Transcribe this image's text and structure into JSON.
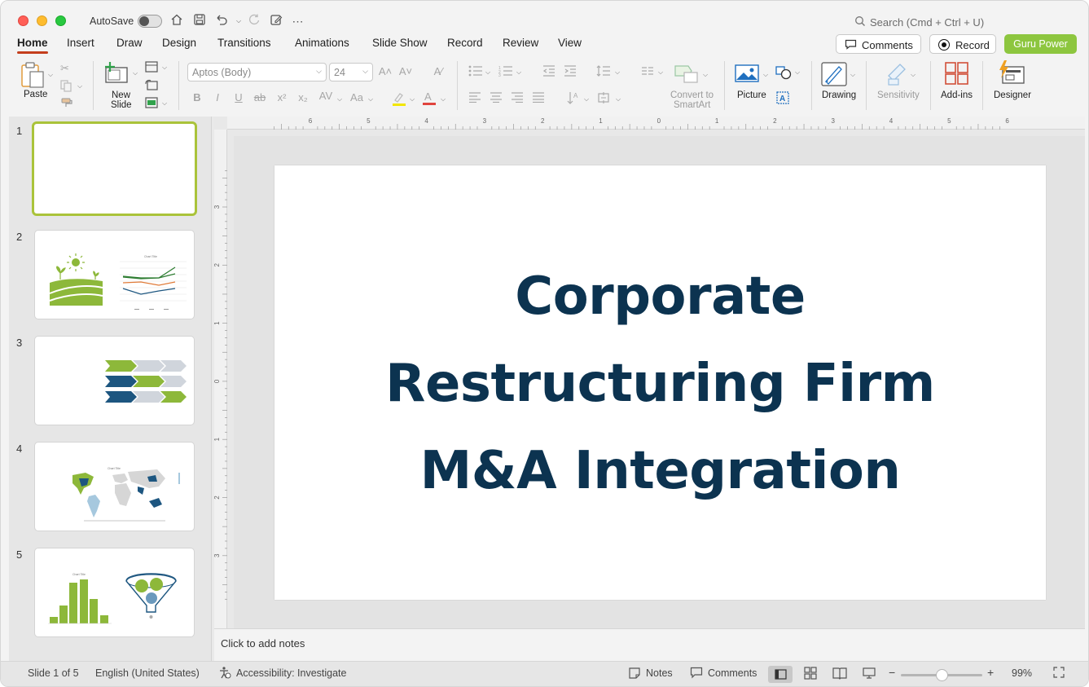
{
  "titlebar": {
    "autosave_label": "AutoSave",
    "search_placeholder": "Search (Cmd + Ctrl + U)"
  },
  "tabs": [
    {
      "label": "Home",
      "active": true
    },
    {
      "label": "Insert"
    },
    {
      "label": "Draw"
    },
    {
      "label": "Design"
    },
    {
      "label": "Transitions"
    },
    {
      "label": "Animations"
    },
    {
      "label": "Slide Show"
    },
    {
      "label": "Record"
    },
    {
      "label": "Review"
    },
    {
      "label": "View"
    }
  ],
  "header_buttons": {
    "comments": "Comments",
    "record": "Record",
    "guru_power": "Guru Power"
  },
  "ribbon": {
    "paste": "Paste",
    "new_slide_1": "New",
    "new_slide_2": "Slide",
    "font_name": "Aptos (Body)",
    "font_size": "24",
    "convert_smartart_1": "Convert to",
    "convert_smartart_2": "SmartArt",
    "picture": "Picture",
    "drawing": "Drawing",
    "sensitivity": "Sensitivity",
    "addins": "Add-ins",
    "designer": "Designer"
  },
  "slides": [
    {
      "number": "1",
      "selected": true
    },
    {
      "number": "2",
      "chart_title": "Chart Title"
    },
    {
      "number": "3"
    },
    {
      "number": "4",
      "chart_title": "Chart Title"
    },
    {
      "number": "5",
      "chart_title": "Chart Title"
    }
  ],
  "ruler": {
    "h_ticks": [
      "6",
      "5",
      "4",
      "3",
      "2",
      "1",
      "0",
      "1",
      "2",
      "3",
      "4",
      "5",
      "6"
    ],
    "v_ticks": [
      "3",
      "2",
      "1",
      "0",
      "1",
      "2",
      "3"
    ]
  },
  "slide": {
    "title_line1": "Corporate",
    "title_line2": "Restructuring Firm",
    "title_line3": "M&A Integration",
    "title_color": "#0c3350"
  },
  "notes_placeholder": "Click to add notes",
  "statusbar": {
    "slide_count": "Slide 1 of 5",
    "language": "English (United States)",
    "accessibility": "Accessibility: Investigate",
    "notes": "Notes",
    "comments": "Comments",
    "zoom": "99%"
  },
  "colors": {
    "accent_green": "#8dc63f",
    "dark_blue": "#1d5680",
    "gray": "#d0d5dc",
    "active_tab_underline": "#c43e1c"
  }
}
